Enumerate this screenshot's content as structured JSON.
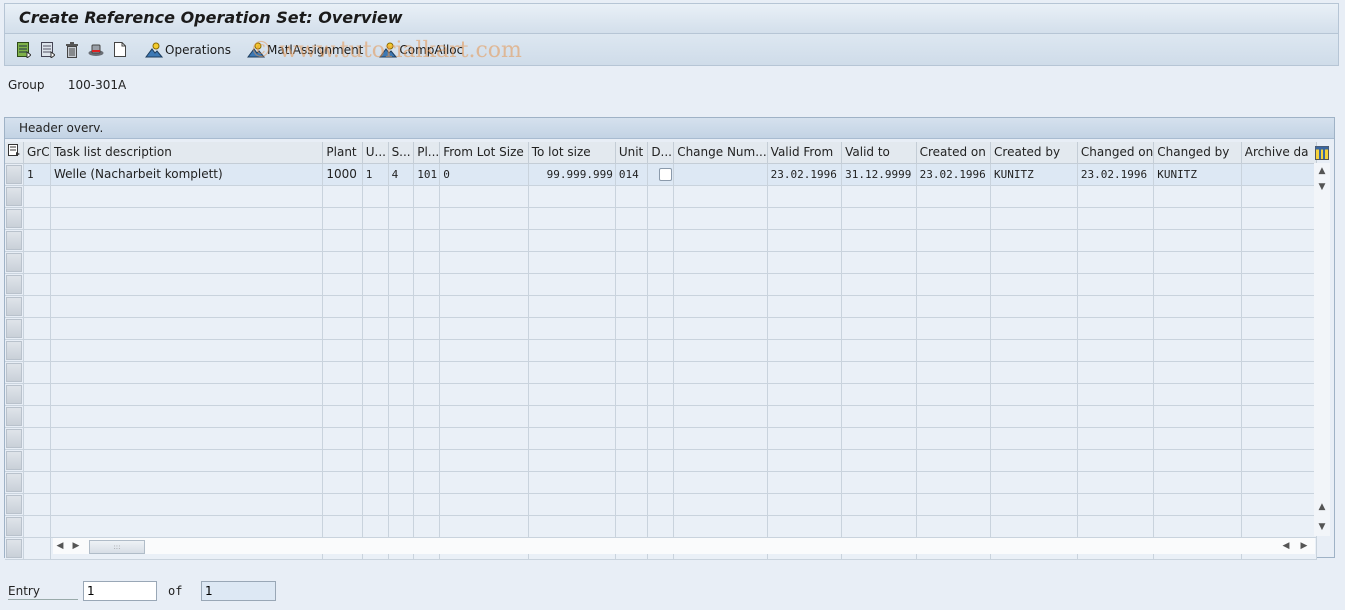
{
  "window": {
    "title": "Create Reference Operation Set: Overview"
  },
  "toolbar": {
    "icons": [
      "table-settings-icon",
      "detail-icon",
      "delete-icon",
      "hat-icon",
      "new-document-icon"
    ],
    "buttons": [
      {
        "label": "Operations",
        "icon": "mountain-person-icon"
      },
      {
        "label": "MatlAssignment",
        "icon": "mountain-person-icon"
      },
      {
        "label": "CompAlloc",
        "icon": "mountain-person-icon"
      }
    ]
  },
  "watermark": "© www.tutorialkart.com",
  "group": {
    "label": "Group",
    "value": "100-301A"
  },
  "panel": {
    "title": "Header overv."
  },
  "table": {
    "columns": [
      "GrC",
      "Task list description",
      "Plant",
      "U...",
      "S...",
      "Pl...",
      "From Lot Size",
      "To lot size",
      "Unit",
      "D...",
      "Change Num...",
      "Valid From",
      "Valid to",
      "Created on",
      "Created by",
      "Changed on",
      "Changed by",
      "Archive da"
    ],
    "rows": [
      [
        "1",
        "Welle (Nacharbeit komplett)",
        "1000",
        "1",
        "4",
        "101",
        "0",
        "99.999.999",
        "014",
        "",
        "",
        "23.02.1996",
        "31.12.9999",
        "23.02.1996",
        "KUNITZ",
        "23.02.1996",
        "KUNITZ",
        ""
      ]
    ],
    "empty_rows": 17
  },
  "entry": {
    "label": "Entry",
    "value": "1",
    "of_label": "of",
    "total": "1"
  }
}
